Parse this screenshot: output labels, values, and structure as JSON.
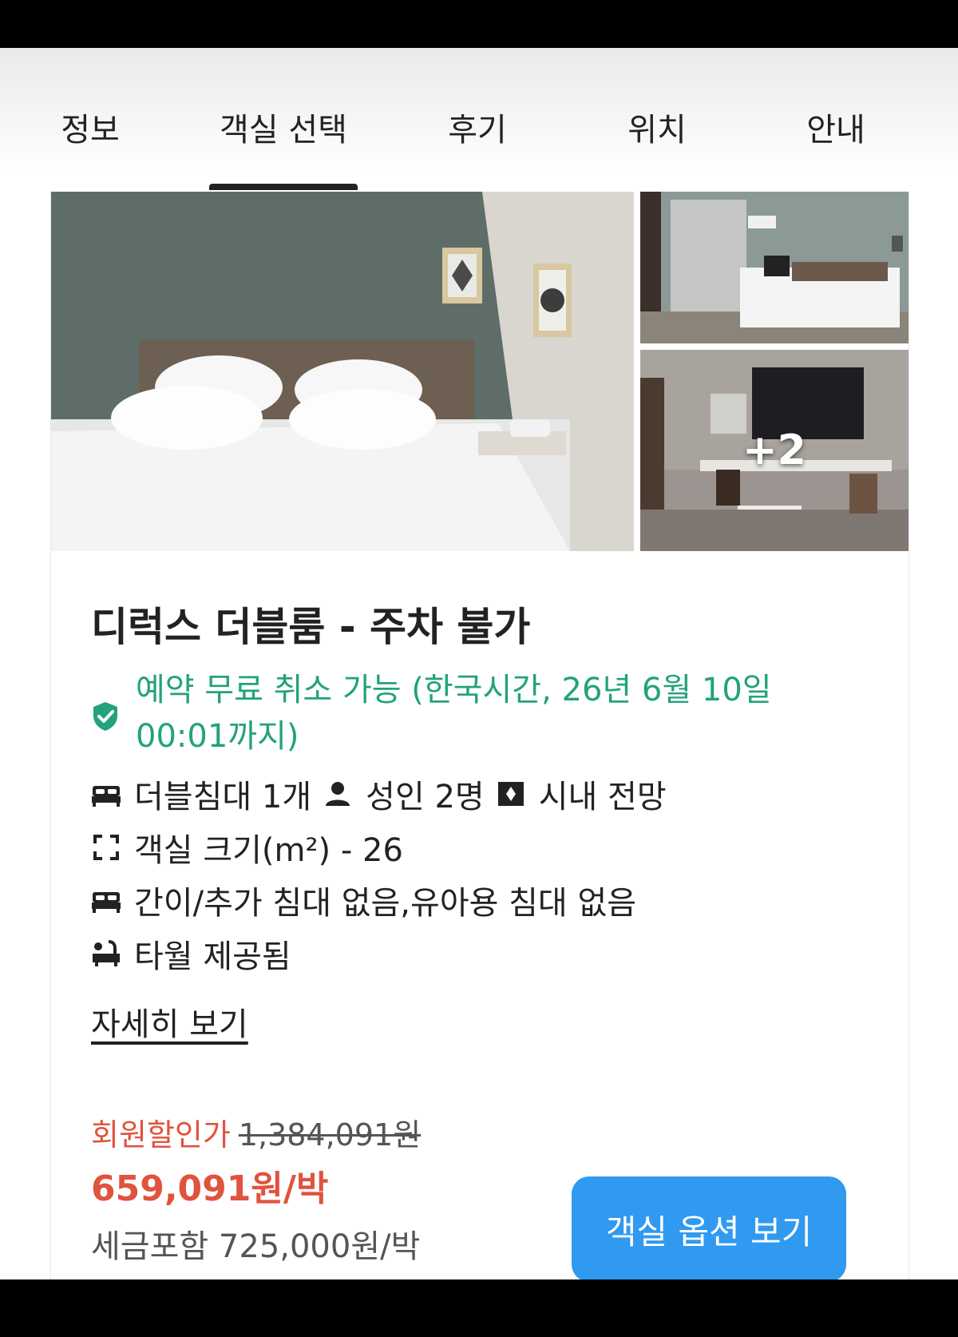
{
  "tabs": [
    {
      "label": "정보"
    },
    {
      "label": "객실 선택",
      "active": true
    },
    {
      "label": "후기"
    },
    {
      "label": "위치"
    },
    {
      "label": "안내"
    }
  ],
  "gallery": {
    "more_count": "+2"
  },
  "room": {
    "title": "디럭스 더블룸 - 주차 불가",
    "cancellation": "예약 무료 취소 가능 (한국시간, 26년 6월 10일 00:01까지)",
    "bed": "더블침대 1개",
    "guests": "성인 2명",
    "view": "시내 전망",
    "size": "객실 크기(m²) - 26",
    "extra_bed": "간이/추가 침대 없음,유아용 침대 없음",
    "towel": "타월 제공됨",
    "details_link": "자세히 보기"
  },
  "price": {
    "member_label": "회원할인가",
    "original": "1,384,091원",
    "sale": "659,091원/박",
    "tax_included": "세금포함 725,000원/박"
  },
  "cta": {
    "label": "객실 옵션 보기"
  },
  "colors": {
    "green": "#23a27c",
    "red": "#e0533d",
    "blue": "#2f9af0"
  },
  "icons": [
    "shield-check-icon",
    "bed-icon",
    "person-icon",
    "window-view-icon",
    "room-size-icon",
    "bath-icon"
  ]
}
